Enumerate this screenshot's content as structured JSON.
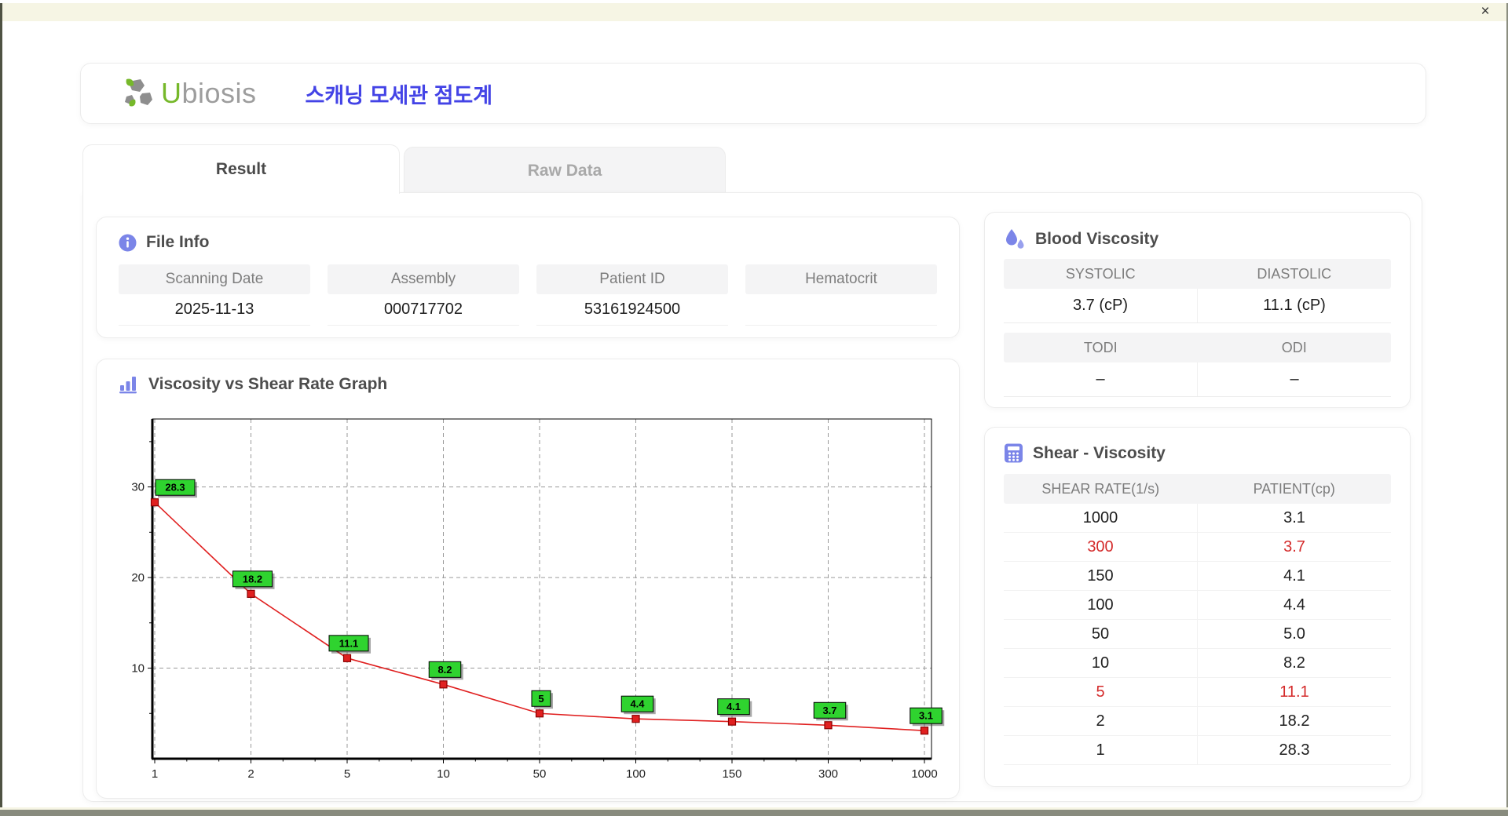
{
  "window": {
    "close_label": "×"
  },
  "header": {
    "logo_u": "U",
    "logo_rest": "biosis",
    "app_title": "스캐닝 모세관 점도계"
  },
  "tabs": [
    {
      "label": "Result",
      "active": true
    },
    {
      "label": "Raw Data",
      "active": false
    }
  ],
  "file_info": {
    "title": "File Info",
    "fields": [
      {
        "label": "Scanning Date",
        "value": "2025-11-13"
      },
      {
        "label": "Assembly",
        "value": "000717702"
      },
      {
        "label": "Patient ID",
        "value": "53161924500"
      },
      {
        "label": "Hematocrit",
        "value": ""
      }
    ]
  },
  "blood_viscosity": {
    "title": "Blood Viscosity",
    "groups": [
      [
        {
          "label": "SYSTOLIC",
          "value": "3.7 (cP)"
        },
        {
          "label": "DIASTOLIC",
          "value": "11.1 (cP)"
        }
      ],
      [
        {
          "label": "TODI",
          "value": "–"
        },
        {
          "label": "ODI",
          "value": "–"
        }
      ]
    ]
  },
  "shear_viscosity": {
    "title": "Shear - Viscosity",
    "columns": [
      "SHEAR RATE(1/s)",
      "PATIENT(cp)"
    ],
    "rows": [
      {
        "shear_rate": "1000",
        "patient": "3.1",
        "highlight": false
      },
      {
        "shear_rate": "300",
        "patient": "3.7",
        "highlight": true
      },
      {
        "shear_rate": "150",
        "patient": "4.1",
        "highlight": false
      },
      {
        "shear_rate": "100",
        "patient": "4.4",
        "highlight": false
      },
      {
        "shear_rate": "50",
        "patient": "5.0",
        "highlight": false
      },
      {
        "shear_rate": "10",
        "patient": "8.2",
        "highlight": false
      },
      {
        "shear_rate": "5",
        "patient": "11.1",
        "highlight": true
      },
      {
        "shear_rate": "2",
        "patient": "18.2",
        "highlight": false
      },
      {
        "shear_rate": "1",
        "patient": "28.3",
        "highlight": false
      }
    ]
  },
  "chart_data": {
    "type": "line",
    "title": "Viscosity vs Shear Rate Graph",
    "xlabel": "",
    "ylabel": "",
    "x": [
      1,
      2,
      5,
      10,
      50,
      100,
      150,
      300,
      1000
    ],
    "values": [
      28.3,
      18.2,
      11.1,
      8.2,
      5,
      4.4,
      4.1,
      3.7,
      3.1
    ],
    "point_labels": [
      "28.3",
      "18.2",
      "11.1",
      "8.2",
      "5",
      "4.4",
      "4.1",
      "3.7",
      "3.1"
    ],
    "x_tick_labels": [
      "1",
      "2",
      "5",
      "10",
      "50",
      "100",
      "150",
      "300",
      "1000"
    ],
    "y_ticks": [
      10,
      20,
      30
    ],
    "y_minor_ticks": [
      5,
      15,
      25,
      35
    ],
    "ylim": [
      0,
      37.5
    ],
    "x_axis_spacing": "even",
    "grid": "dashed",
    "legend": "none"
  },
  "colors": {
    "accent": "#7b85e8",
    "accent_light": "#98a0ee",
    "title_blue": "#4343e6",
    "logo_green": "#76b82a",
    "logo_gray": "#8e8e8e",
    "line_red": "#e02020",
    "marker_stroke": "#8b0000",
    "label_box_green": "#2fd32f",
    "grid_gray": "#9a9a9a",
    "highlight_red": "#d42a2a"
  }
}
